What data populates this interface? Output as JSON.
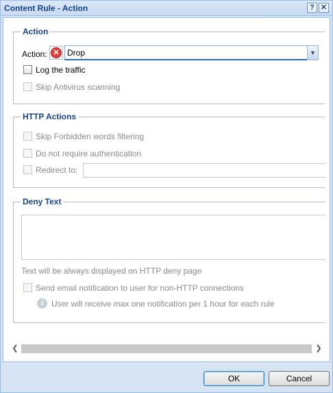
{
  "window": {
    "title": "Content Rule - Action",
    "help_glyph": "?",
    "close_glyph": "✕"
  },
  "action_section": {
    "legend": "Action",
    "action_label": "Action:",
    "action_icon": "deny-icon",
    "action_value": "Drop",
    "log_traffic_label": "Log the traffic",
    "log_traffic_checked": false,
    "skip_antivirus_label": "Skip Antivirus scanning",
    "skip_antivirus_checked": false
  },
  "http_section": {
    "legend": "HTTP Actions",
    "skip_forbidden_label": "Skip Forbidden words filtering",
    "no_auth_label": "Do not require authentication",
    "redirect_label": "Redirect to:",
    "redirect_value": ""
  },
  "deny_section": {
    "legend": "Deny Text",
    "deny_text_value": "",
    "hint": "Text will be always displayed on HTTP deny page",
    "email_label": "Send email notification to user for non-HTTP connections",
    "info_note": "User will receive max one notification per 1 hour for each rule"
  },
  "scroll": {
    "left_glyph": "❮",
    "right_glyph": "❯"
  },
  "buttons": {
    "ok": "OK",
    "cancel": "Cancel"
  }
}
